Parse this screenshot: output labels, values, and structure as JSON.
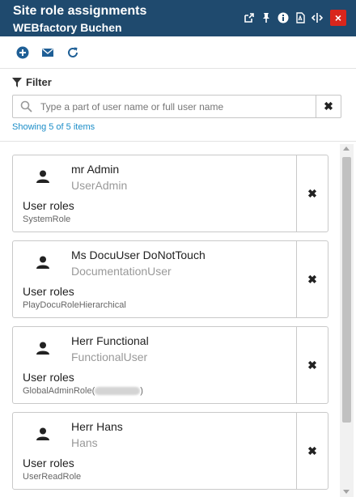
{
  "header": {
    "title": "Site role assignments",
    "subtitle": "WEBfactory Buchen",
    "close_label": "×",
    "icons": [
      "popout-icon",
      "pin-icon",
      "info-icon",
      "pdf-icon",
      "resize-icon",
      "close-icon"
    ]
  },
  "toolbar": {
    "icons": [
      "add-icon",
      "email-icon",
      "refresh-icon"
    ],
    "accent_color": "#1f5f96"
  },
  "filter": {
    "label": "Filter",
    "search_placeholder": "Type a part of user name or full user name",
    "clear_label": "✖",
    "showing_text": "Showing 5 of 5 items"
  },
  "assignments": [
    {
      "name": "mr Admin",
      "username": "UserAdmin",
      "roles_label": "User roles",
      "roles": "SystemRole",
      "remove_label": "✖"
    },
    {
      "name": "Ms DocuUser DoNotTouch",
      "username": "DocumentationUser",
      "roles_label": "User roles",
      "roles": "PlayDocuRoleHierarchical",
      "remove_label": "✖"
    },
    {
      "name": "Herr Functional",
      "username": "FunctionalUser",
      "roles_label": "User roles",
      "roles": "GlobalAdminRole(",
      "roles_suffix": ")",
      "remove_label": "✖"
    },
    {
      "name": "Herr Hans",
      "username": "Hans",
      "roles_label": "User roles",
      "roles": "UserReadRole",
      "remove_label": "✖"
    }
  ],
  "colors": {
    "header_bg": "#1f4a6e",
    "close_bg": "#d9261c",
    "link": "#1b8dc8"
  }
}
